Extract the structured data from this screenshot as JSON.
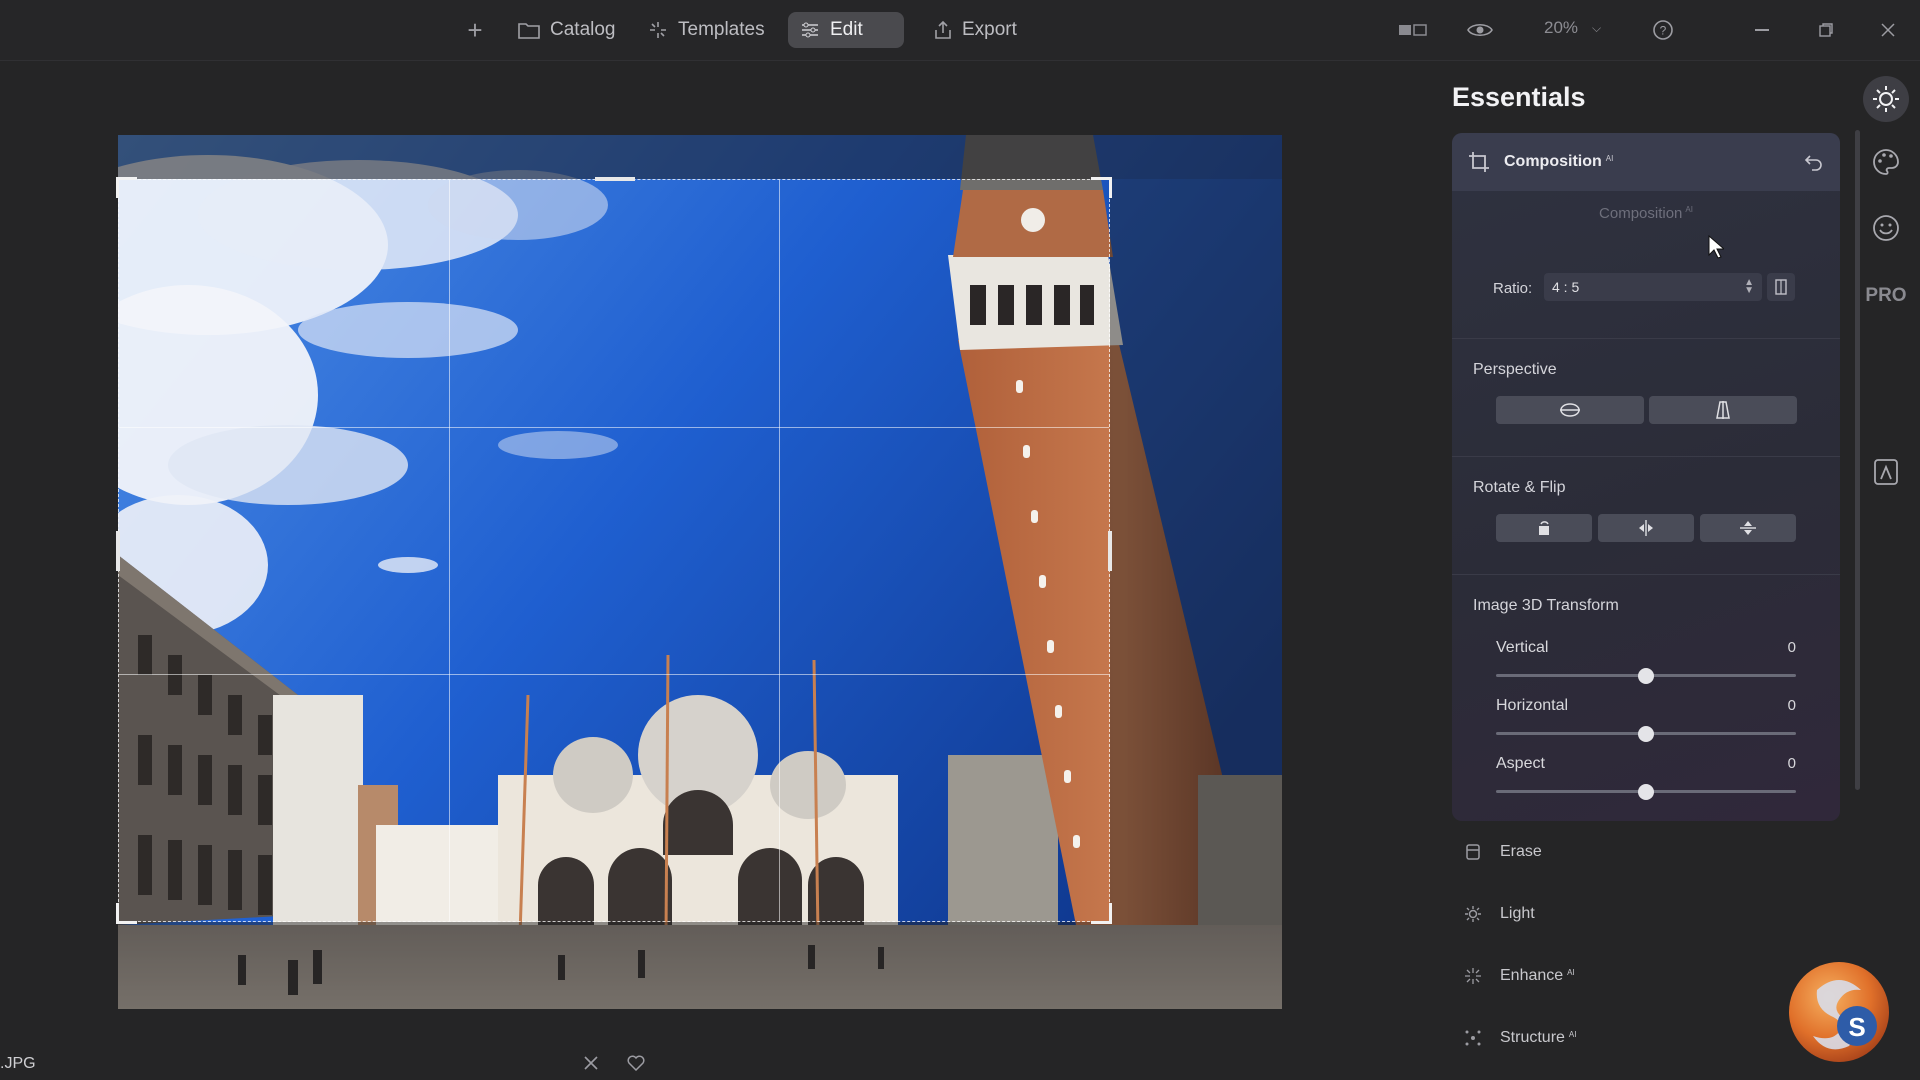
{
  "topbar": {
    "nav": [
      {
        "label": "Catalog",
        "icon": "folder-icon"
      },
      {
        "label": "Templates",
        "icon": "sparkle-icon"
      },
      {
        "label": "Edit",
        "icon": "sliders-icon",
        "active": true
      },
      {
        "label": "Export",
        "icon": "export-icon"
      }
    ],
    "add_icon": "plus-icon",
    "zoom": "20%"
  },
  "file": {
    "name": ".JPG"
  },
  "panel": {
    "title": "Essentials",
    "composition": {
      "header": "Composition",
      "ai_badge": "AI",
      "subheading": "Composition",
      "ratio_label": "Ratio:",
      "ratio_value": "4 : 5"
    },
    "perspective": {
      "title": "Perspective"
    },
    "rotate_flip": {
      "title": "Rotate & Flip"
    },
    "transform3d": {
      "title": "Image 3D Transform",
      "sliders": [
        {
          "label": "Vertical",
          "value": "0",
          "fraction": 0.5
        },
        {
          "label": "Horizontal",
          "value": "0",
          "fraction": 0.5
        },
        {
          "label": "Aspect",
          "value": "0",
          "fraction": 0.5
        }
      ]
    },
    "tools": [
      {
        "label": "Erase",
        "ai": false
      },
      {
        "label": "Light",
        "ai": false
      },
      {
        "label": "Enhance",
        "ai": true
      },
      {
        "label": "Structure",
        "ai": true
      }
    ]
  },
  "sidebar": {
    "pro_label": "PRO"
  },
  "colors": {
    "accent": "#4a4a4e",
    "panel": "#2f3240",
    "sky": "#1f5fd0"
  }
}
